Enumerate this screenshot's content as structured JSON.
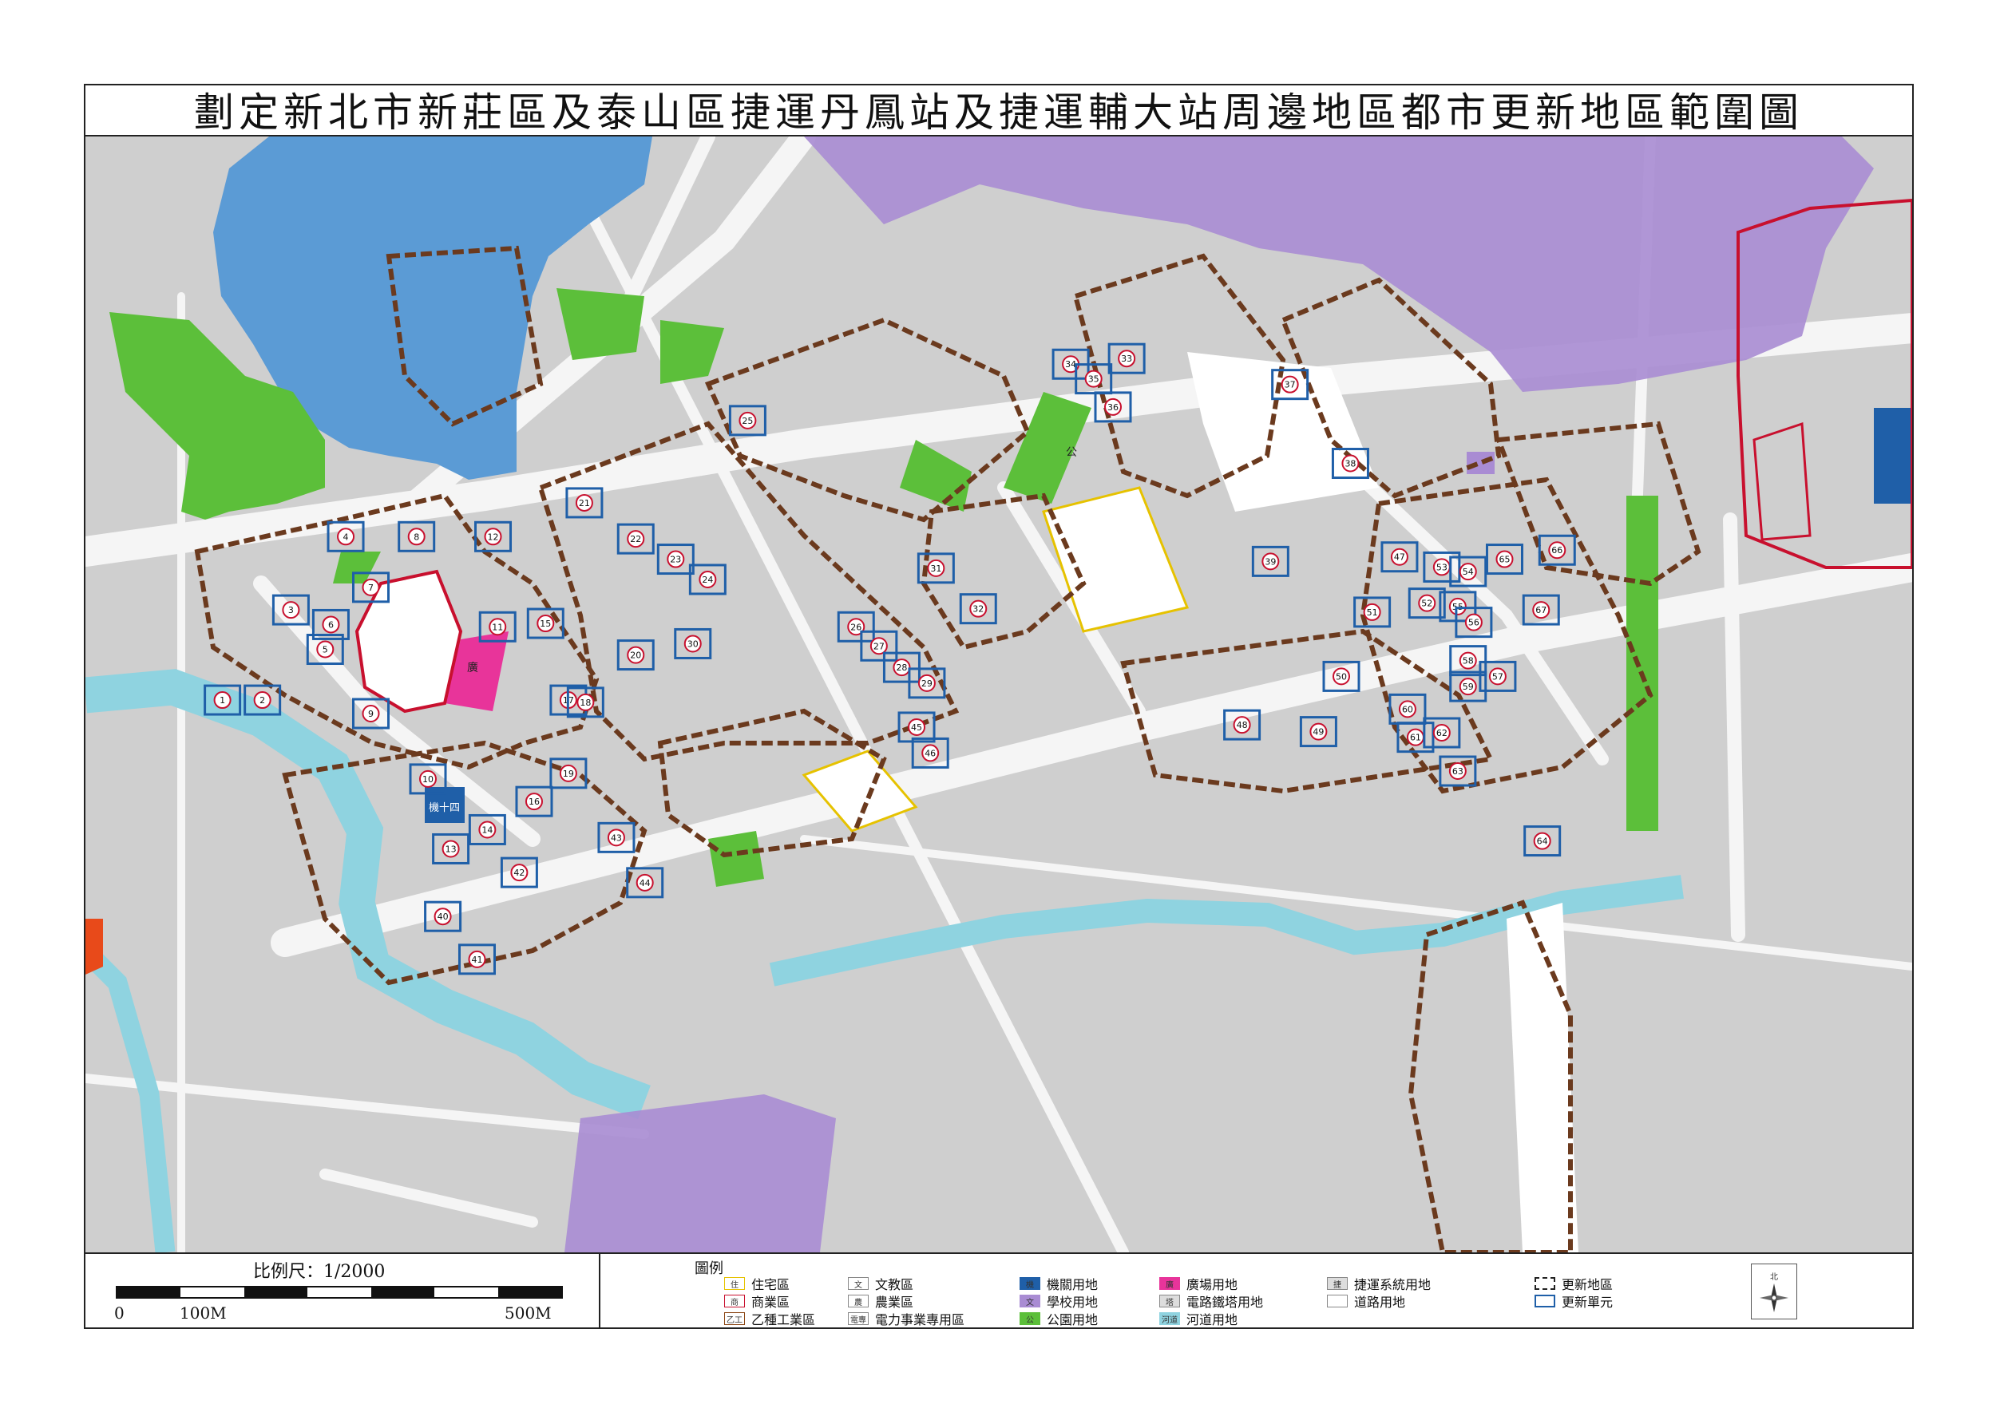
{
  "title": "劃定新北市新莊區及泰山區捷運丹鳳站及捷運輔大站周邊地區都市更新地區範圍圖",
  "scale": {
    "title": "比例尺：1/2000",
    "label_0": "0",
    "label_100": "100M",
    "label_500": "500M"
  },
  "legend": {
    "title": "圖例",
    "items": [
      {
        "label": "住宅區",
        "swatch_text": "住",
        "fill": "#ffffff",
        "border": "#e6c200"
      },
      {
        "label": "商業區",
        "swatch_text": "商",
        "fill": "#ffffff",
        "border": "#c8102e"
      },
      {
        "label": "乙種工業區",
        "swatch_text": "乙工",
        "fill": "#ffffff",
        "border": "#8b4513"
      },
      {
        "label": "文教區",
        "swatch_text": "文",
        "fill": "#ffffff",
        "border": "#888888"
      },
      {
        "label": "農業區",
        "swatch_text": "農",
        "fill": "#ffffff",
        "border": "#888888"
      },
      {
        "label": "電力事業專用區",
        "swatch_text": "電專",
        "fill": "#ffffff",
        "border": "#888888"
      },
      {
        "label": "機關用地",
        "swatch_text": "機",
        "fill": "#1f5fa8",
        "border": "#1f5fa8"
      },
      {
        "label": "學校用地",
        "swatch_text": "文",
        "fill": "#a98cd3",
        "border": "#a98cd3"
      },
      {
        "label": "公園用地",
        "swatch_text": "公",
        "fill": "#5cbf3a",
        "border": "#5cbf3a"
      },
      {
        "label": "廣場用地",
        "swatch_text": "廣",
        "fill": "#e8349a",
        "border": "#e8349a"
      },
      {
        "label": "電路鐵塔用地",
        "swatch_text": "塔",
        "fill": "#dddddd",
        "border": "#888888"
      },
      {
        "label": "河道用地",
        "swatch_text": "河道",
        "fill": "#8fd3e0",
        "border": "#8fd3e0"
      },
      {
        "label": "捷運系統用地",
        "swatch_text": "捷",
        "fill": "#dddddd",
        "border": "#888888"
      },
      {
        "label": "道路用地",
        "swatch_text": "",
        "fill": "#ffffff",
        "border": "#888888"
      },
      {
        "label": "更新地區",
        "swatch_text": "",
        "fill": "#ffffff",
        "border": "#222222"
      },
      {
        "label": "更新單元",
        "swatch_text": "",
        "fill": "#ffffff",
        "border": "#1f5fa8"
      }
    ]
  },
  "map_labels": {
    "institution": "機十四",
    "plaza": "廣",
    "park": "公"
  },
  "units": [
    "1",
    "2",
    "3",
    "4",
    "5",
    "6",
    "7",
    "8",
    "9",
    "10",
    "11",
    "12",
    "13",
    "14",
    "15",
    "16",
    "17",
    "18",
    "19",
    "20",
    "21",
    "22",
    "23",
    "24",
    "25",
    "26",
    "27",
    "28",
    "29",
    "30",
    "31",
    "32",
    "33",
    "34",
    "35",
    "36",
    "37",
    "38",
    "39",
    "40",
    "41",
    "42",
    "43",
    "44",
    "45",
    "46",
    "47",
    "48",
    "49",
    "50",
    "51",
    "52",
    "53",
    "54",
    "55",
    "56",
    "57",
    "58",
    "59",
    "60",
    "61",
    "62",
    "63",
    "64",
    "65",
    "66",
    "67"
  ],
  "compass_label": "北",
  "colors": {
    "water": "#5b9bd5",
    "river": "#8fd3e0",
    "school": "#a98cd3",
    "park": "#5cbf3a",
    "plaza": "#e8349a",
    "institution": "#1f5fa8",
    "renewal_area": "#6b3a1e",
    "renewal_unit": "#1f5fa8",
    "commercial": "#c8102e",
    "residential": "#e6c200"
  }
}
